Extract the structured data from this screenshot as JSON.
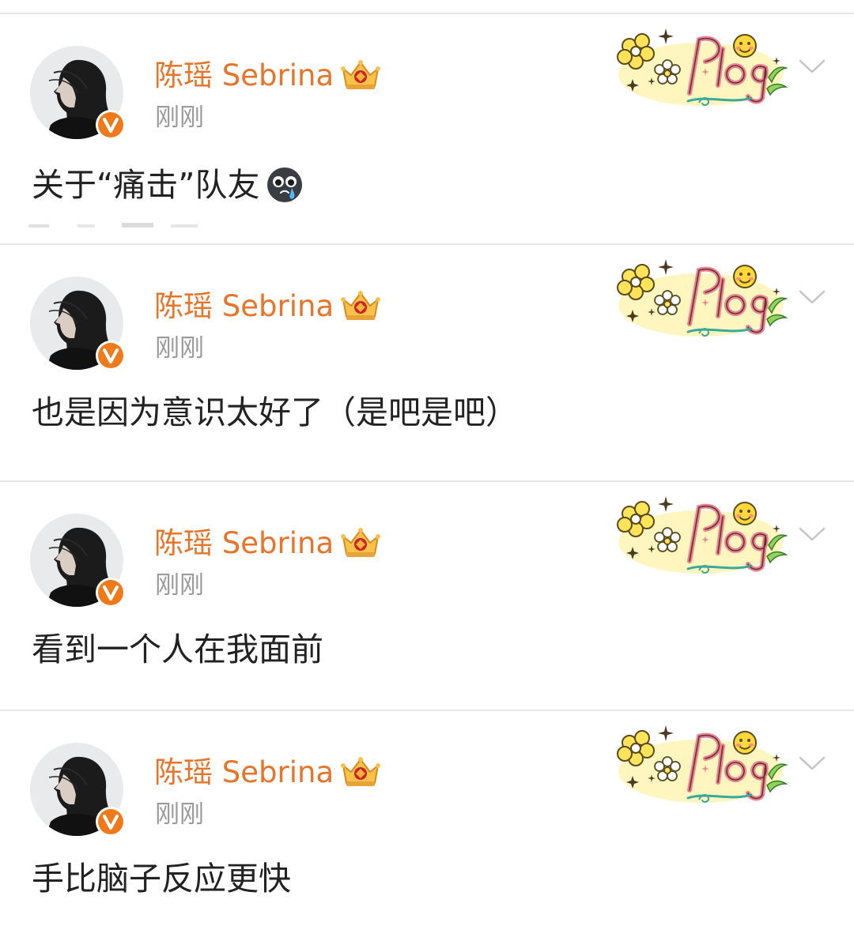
{
  "colors": {
    "username": "#e8742a",
    "timestamp": "#9a9a9a",
    "text": "#222222",
    "verified_badge": "#f07a1a",
    "divider": "#e6e6e6"
  },
  "posts": [
    {
      "username": "陈瑶 Sebrina",
      "timestamp": "刚刚",
      "text": "关于“痛击”队友",
      "emoji": "crying-face-emoji",
      "badge": "Plog"
    },
    {
      "username": "陈瑶 Sebrina",
      "timestamp": "刚刚",
      "text": "也是因为意识太好了（是吧是吧）",
      "badge": "Plog"
    },
    {
      "username": "陈瑶 Sebrina",
      "timestamp": "刚刚",
      "text": "看到一个人在我面前",
      "badge": "Plog"
    },
    {
      "username": "陈瑶 Sebrina",
      "timestamp": "刚刚",
      "text": "手比脑子反应更快",
      "badge": "Plog"
    }
  ]
}
